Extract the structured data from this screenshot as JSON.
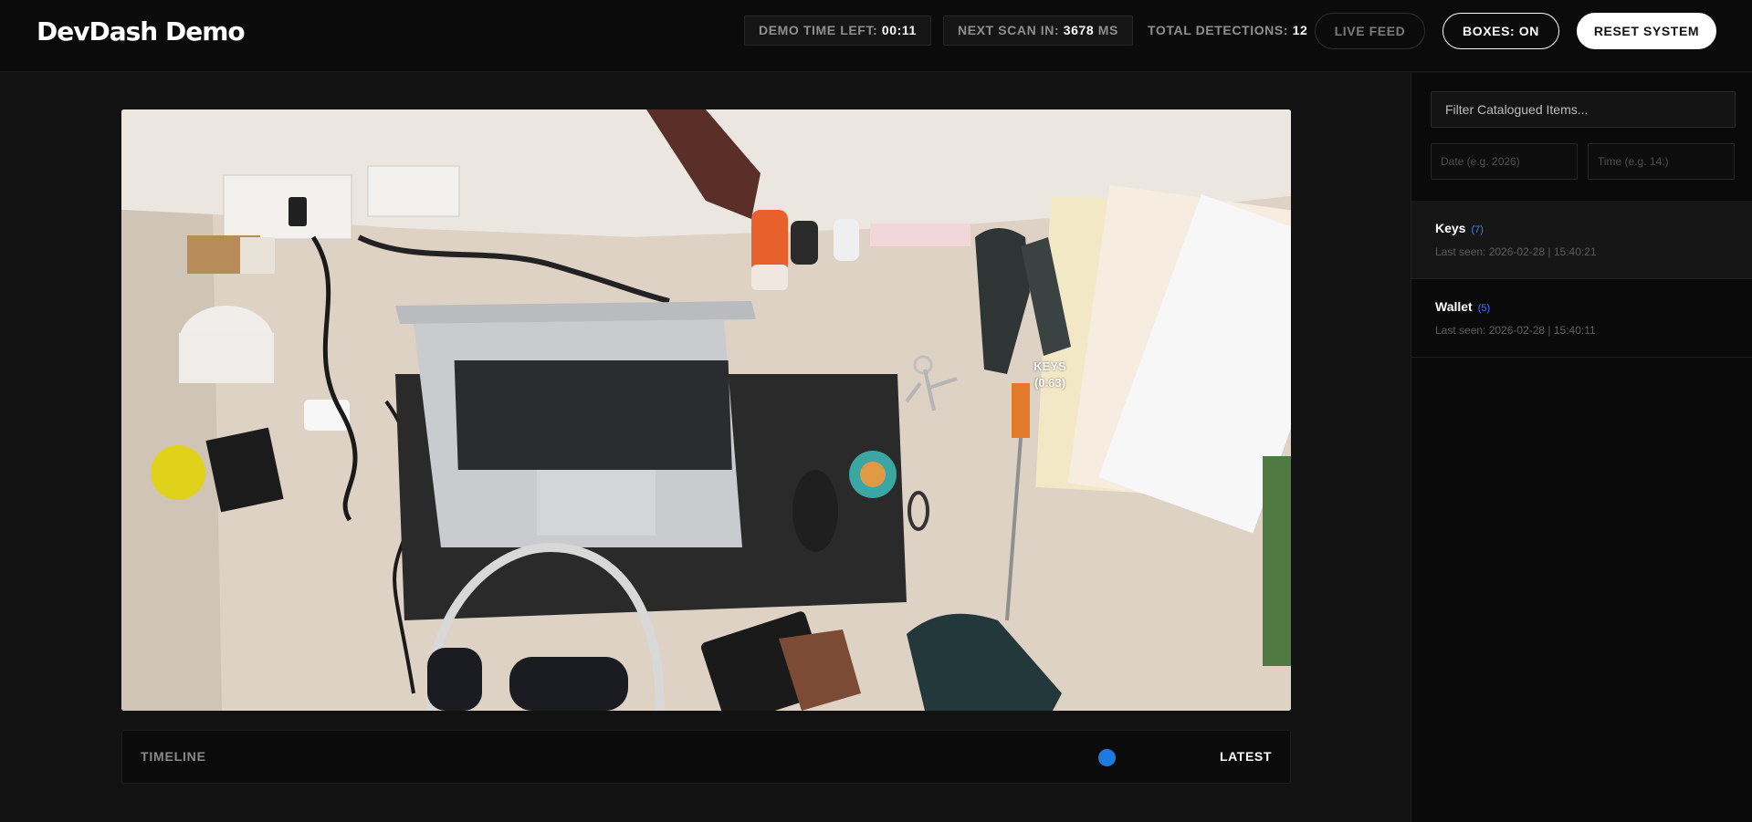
{
  "header": {
    "brand": "DevDash Demo",
    "demo_time_label": "DEMO TIME LEFT:",
    "demo_time_value": "00:11",
    "next_scan_label": "NEXT SCAN IN:",
    "next_scan_value": "3678",
    "next_scan_unit": "MS",
    "total_detections_label": "TOTAL DETECTIONS:",
    "total_detections_value": "12",
    "live_feed_button": "LIVE FEED",
    "boxes_button": "BOXES: ON",
    "reset_button": "RESET SYSTEM"
  },
  "camera": {
    "detection": {
      "label": "KEYS",
      "confidence": "(0.63)"
    }
  },
  "timeline": {
    "label": "TIMELINE",
    "latest": "LATEST"
  },
  "sidebar": {
    "filter_placeholder": "Filter Catalogued Items...",
    "date_placeholder": "Date (e.g. 2026)",
    "time_placeholder": "Time (e.g. 14:)",
    "items": [
      {
        "name": "Keys",
        "count": "(7)",
        "last_seen": "Last seen: 2026-02-28 | 15:40:21"
      },
      {
        "name": "Wallet",
        "count": "(5)",
        "last_seen": "Last seen: 2026-02-28 | 15:40:11"
      }
    ]
  },
  "colors": {
    "accent": "#1f7ae0",
    "count": "#3b82f6",
    "background": "#111111"
  }
}
